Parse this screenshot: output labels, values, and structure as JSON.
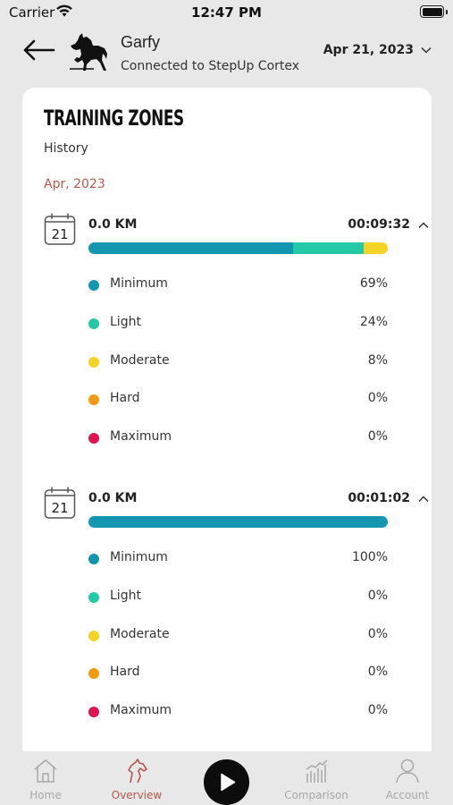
{
  "status_bar": {
    "carrier": "Carrier",
    "time": "12:47 PM"
  },
  "header": {
    "horse_name": "Garfy",
    "connection_status": "Connected to StepUp Cortex",
    "selected_date": "Apr 21, 2023"
  },
  "card": {
    "title": "TRAINING ZONES",
    "subtitle": "History",
    "month": "Apr, 2023"
  },
  "zone_colors": {
    "Minimum": "#1596b0",
    "Light": "#24c9a8",
    "Moderate": "#f5d426",
    "Hard": "#f39c12",
    "Maximum": "#e0154f"
  },
  "sessions": [
    {
      "day": "21",
      "distance": "0.0 KM",
      "duration": "00:09:32",
      "zones": [
        {
          "name": "Minimum",
          "percent": "69%",
          "fraction": 0.69
        },
        {
          "name": "Light",
          "percent": "24%",
          "fraction": 0.24
        },
        {
          "name": "Moderate",
          "percent": "8%",
          "fraction": 0.08
        },
        {
          "name": "Hard",
          "percent": "0%",
          "fraction": 0
        },
        {
          "name": "Maximum",
          "percent": "0%",
          "fraction": 0
        }
      ]
    },
    {
      "day": "21",
      "distance": "0.0 KM",
      "duration": "00:01:02",
      "zones": [
        {
          "name": "Minimum",
          "percent": "100%",
          "fraction": 1.0
        },
        {
          "name": "Light",
          "percent": "0%",
          "fraction": 0
        },
        {
          "name": "Moderate",
          "percent": "0%",
          "fraction": 0
        },
        {
          "name": "Hard",
          "percent": "0%",
          "fraction": 0
        },
        {
          "name": "Maximum",
          "percent": "0%",
          "fraction": 0
        }
      ]
    }
  ],
  "tab_bar": {
    "home": "Home",
    "overview": "Overview",
    "comparison": "Comparison",
    "account": "Account",
    "active": "overview"
  }
}
